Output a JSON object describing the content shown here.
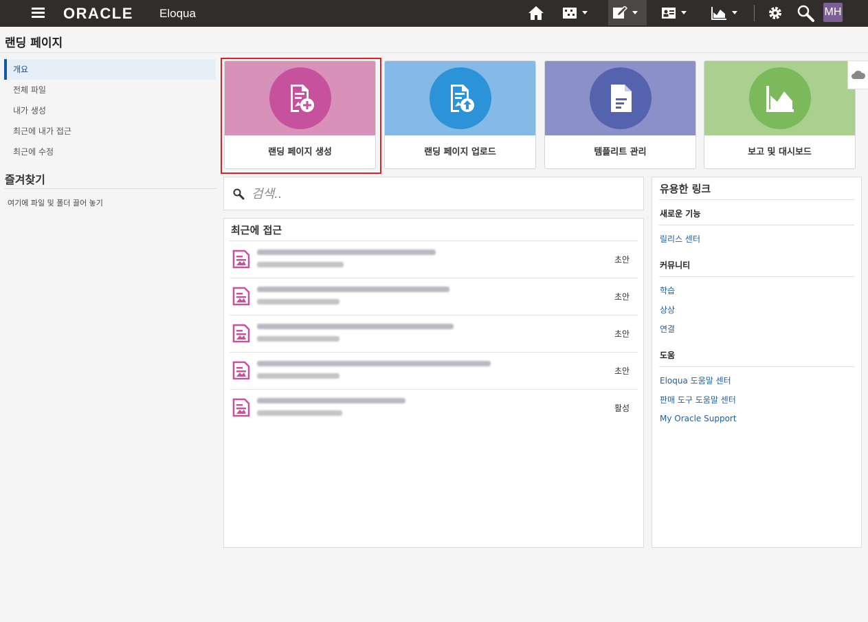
{
  "app": {
    "logo_text": "ORACLE",
    "product_name": "Eloqua",
    "avatar_initials": "MH"
  },
  "page": {
    "title": "랜딩 페이지"
  },
  "sidebar": {
    "items": [
      {
        "label": "개요",
        "active": true
      },
      {
        "label": "전체 파일"
      },
      {
        "label": "내가 생성"
      },
      {
        "label": "최근에 내가 접근"
      },
      {
        "label": "최근에 수정"
      }
    ],
    "favorites_title": "즐겨찾기",
    "favorites_hint": "여기에 파일 및 폴더 끌어 놓기"
  },
  "tiles": [
    {
      "label": "랜딩 페이지 생성",
      "icon": "landing-page-create-icon",
      "bg": "#d892b9",
      "circle": "#c6519c"
    },
    {
      "label": "랜딩 페이지 업로드",
      "icon": "landing-page-upload-icon",
      "bg": "#85b9e6",
      "circle": "#2d93d8"
    },
    {
      "label": "템플리트 관리",
      "icon": "template-icon",
      "bg": "#8b90c9",
      "circle": "#5562ae"
    },
    {
      "label": "보고 및 대시보드",
      "icon": "chart-icon",
      "bg": "#a9d08f",
      "circle": "#7cb95a"
    }
  ],
  "search": {
    "placeholder": "검색.."
  },
  "recent": {
    "title": "최근에 접근",
    "rows": [
      {
        "status": "초안"
      },
      {
        "status": "초안"
      },
      {
        "status": "초안"
      },
      {
        "status": "초안"
      },
      {
        "status": "활성"
      }
    ]
  },
  "useful_links": {
    "title": "유용한 링크",
    "sections": [
      {
        "header": "새로운 기능",
        "links": [
          "릴리스 센터"
        ]
      },
      {
        "header": "커뮤니티",
        "links": [
          "학습",
          "상상",
          "연결"
        ]
      },
      {
        "header": "도움",
        "links": [
          "Eloqua 도움말 센터",
          "판매 도구 도움말 센터",
          "My Oracle Support"
        ]
      }
    ]
  },
  "colors": {
    "topbar": "#312d2a",
    "accent": "#0f5ba7",
    "landing_icon": "#c6519c"
  }
}
